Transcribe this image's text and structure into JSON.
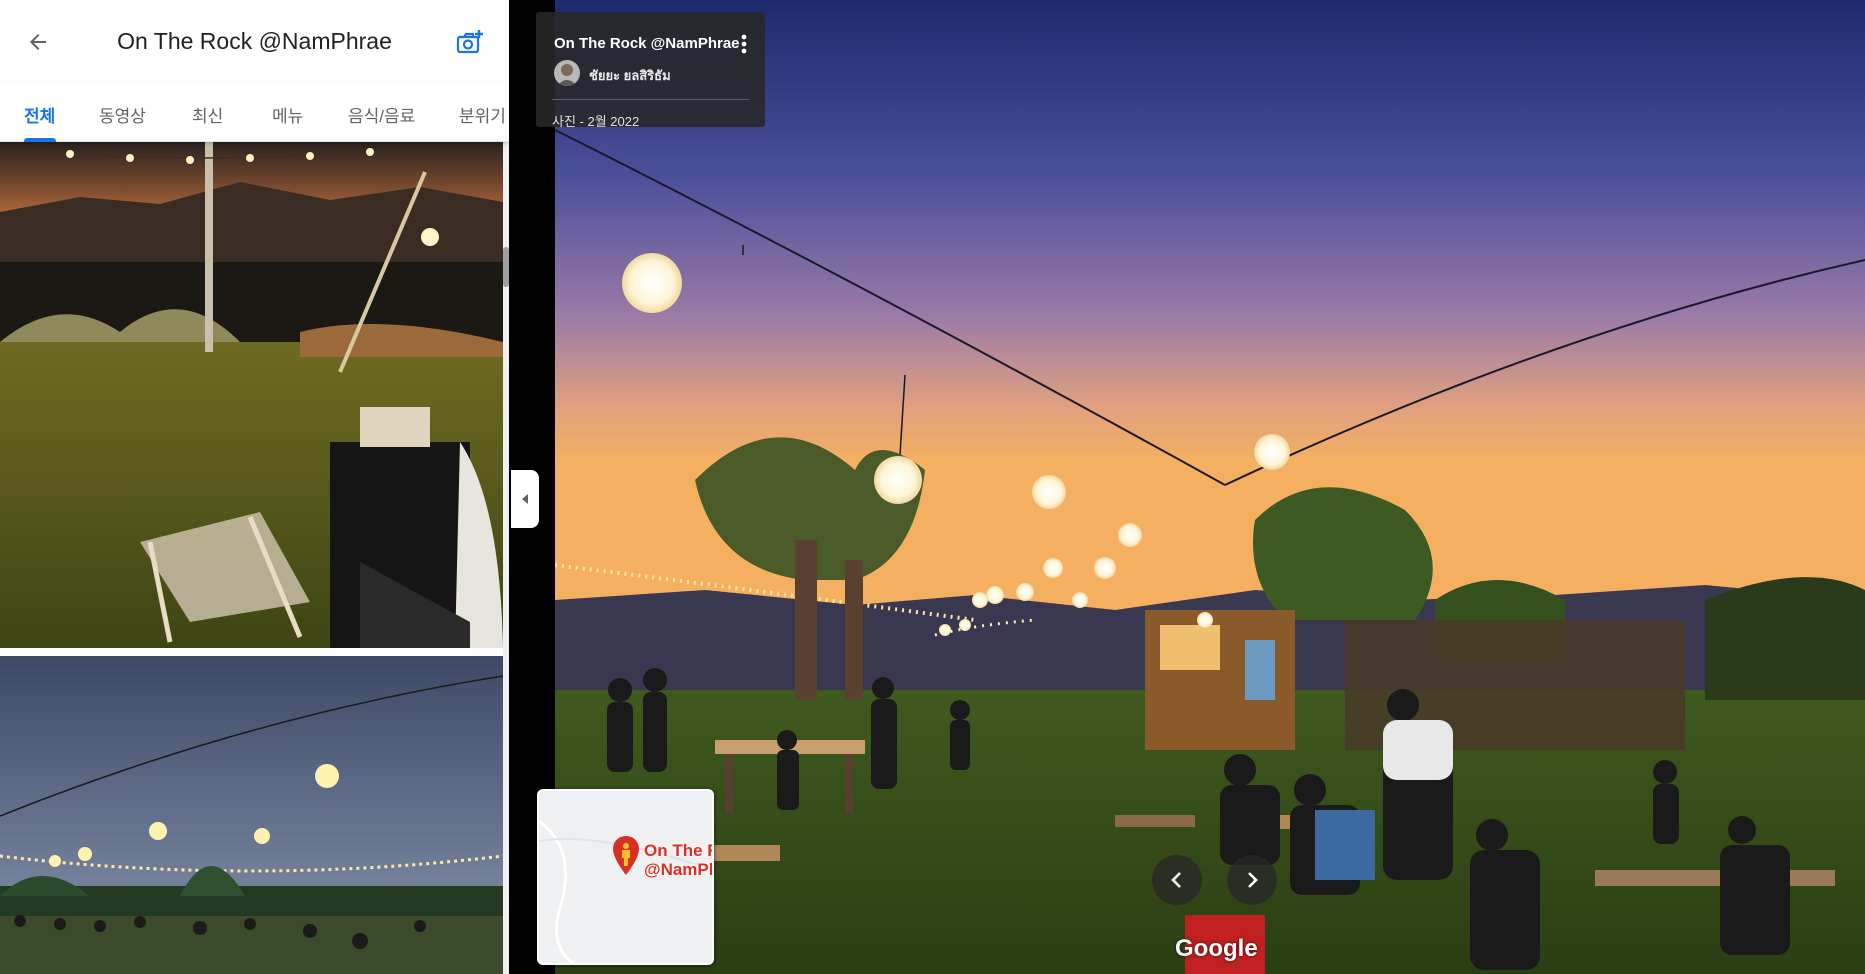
{
  "header": {
    "title": "On The Rock @NamPhrae",
    "back_icon": "arrow-left-icon",
    "add_photo_icon": "add-photo-camera-icon"
  },
  "tabs": [
    {
      "label": "전체",
      "active": true
    },
    {
      "label": "동영상",
      "active": false
    },
    {
      "label": "최신",
      "active": false
    },
    {
      "label": "메뉴",
      "active": false
    },
    {
      "label": "음식/음료",
      "active": false
    },
    {
      "label": "분위기",
      "active": false
    }
  ],
  "photo_info": {
    "title": "On The Rock @NamPhrae",
    "author": "ชัยยะ ยลสิริธัม",
    "date": "사진 - 2월 2022"
  },
  "minimap": {
    "label": "On The R\n@NamPh"
  },
  "logo": "Google",
  "colors": {
    "accent": "#1a73e8",
    "info_card_bg": "#282828",
    "pin": "#d93025"
  }
}
